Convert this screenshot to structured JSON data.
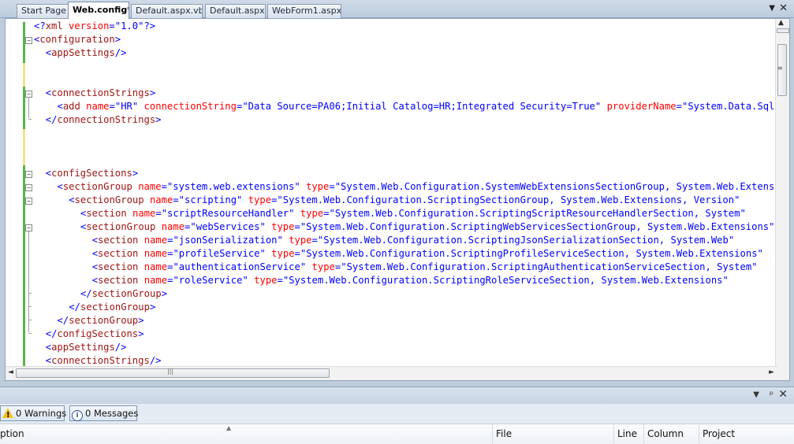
{
  "tabs": [
    {
      "label": "Start Page",
      "active": false
    },
    {
      "label": "Web.config*",
      "active": true
    },
    {
      "label": "Default.aspx.vb",
      "active": false
    },
    {
      "label": "Default.aspx",
      "active": false
    },
    {
      "label": "WebForm1.aspx",
      "active": false
    }
  ],
  "tab_icons": {
    "menu": "dropdown-arrow-icon",
    "close": "close-icon"
  },
  "editor": {
    "lines": [
      {
        "indent": 0,
        "segs": [
          [
            "b",
            "<?"
          ],
          [
            "t",
            "xml"
          ],
          [
            "a",
            " version"
          ],
          [
            "b",
            "="
          ],
          [
            "v",
            "\"1.0\""
          ],
          [
            "b",
            "?>"
          ]
        ]
      },
      {
        "indent": 0,
        "segs": [
          [
            "b",
            "<"
          ],
          [
            "t",
            "configuration"
          ],
          [
            "b",
            ">"
          ]
        ]
      },
      {
        "indent": 1,
        "segs": [
          [
            "b",
            "<"
          ],
          [
            "t",
            "appSettings"
          ],
          [
            "b",
            "/>"
          ]
        ]
      },
      {
        "indent": 0,
        "segs": []
      },
      {
        "indent": 0,
        "segs": []
      },
      {
        "indent": 1,
        "segs": [
          [
            "b",
            "<"
          ],
          [
            "t",
            "connectionStrings"
          ],
          [
            "b",
            ">"
          ]
        ]
      },
      {
        "indent": 2,
        "segs": [
          [
            "b",
            "<"
          ],
          [
            "t",
            "add"
          ],
          [
            "a",
            " name"
          ],
          [
            "b",
            "="
          ],
          [
            "v",
            "\"HR\""
          ],
          [
            "a",
            " connectionString"
          ],
          [
            "b",
            "="
          ],
          [
            "v",
            "\"Data Source=PA06;Initial Catalog=HR;Integrated Security=True\""
          ],
          [
            "a",
            " providerName"
          ],
          [
            "b",
            "="
          ],
          [
            "v",
            "\"System.Data.SqlClient\""
          ]
        ]
      },
      {
        "indent": 1,
        "segs": [
          [
            "b",
            "</"
          ],
          [
            "t",
            "connectionStrings"
          ],
          [
            "b",
            ">"
          ]
        ]
      },
      {
        "indent": 0,
        "segs": []
      },
      {
        "indent": 0,
        "segs": []
      },
      {
        "indent": 0,
        "segs": []
      },
      {
        "indent": 1,
        "segs": [
          [
            "b",
            "<"
          ],
          [
            "t",
            "configSections"
          ],
          [
            "b",
            ">"
          ]
        ]
      },
      {
        "indent": 2,
        "segs": [
          [
            "b",
            "<"
          ],
          [
            "t",
            "sectionGroup"
          ],
          [
            "a",
            " name"
          ],
          [
            "b",
            "="
          ],
          [
            "v",
            "\"system.web.extensions\""
          ],
          [
            "a",
            " type"
          ],
          [
            "b",
            "="
          ],
          [
            "v",
            "\"System.Web.Configuration.SystemWebExtensionsSectionGroup, System.Web.Extensions\""
          ]
        ]
      },
      {
        "indent": 3,
        "segs": [
          [
            "b",
            "<"
          ],
          [
            "t",
            "sectionGroup"
          ],
          [
            "a",
            " name"
          ],
          [
            "b",
            "="
          ],
          [
            "v",
            "\"scripting\""
          ],
          [
            "a",
            " type"
          ],
          [
            "b",
            "="
          ],
          [
            "v",
            "\"System.Web.Configuration.ScriptingSectionGroup, System.Web.Extensions, Version\""
          ]
        ]
      },
      {
        "indent": 4,
        "segs": [
          [
            "b",
            "<"
          ],
          [
            "t",
            "section"
          ],
          [
            "a",
            " name"
          ],
          [
            "b",
            "="
          ],
          [
            "v",
            "\"scriptResourceHandler\""
          ],
          [
            "a",
            " type"
          ],
          [
            "b",
            "="
          ],
          [
            "v",
            "\"System.Web.Configuration.ScriptingScriptResourceHandlerSection, System\""
          ]
        ]
      },
      {
        "indent": 4,
        "segs": [
          [
            "b",
            "<"
          ],
          [
            "t",
            "sectionGroup"
          ],
          [
            "a",
            " name"
          ],
          [
            "b",
            "="
          ],
          [
            "v",
            "\"webServices\""
          ],
          [
            "a",
            " type"
          ],
          [
            "b",
            "="
          ],
          [
            "v",
            "\"System.Web.Configuration.ScriptingWebServicesSectionGroup, System.Web.Extensions\""
          ]
        ]
      },
      {
        "indent": 5,
        "segs": [
          [
            "b",
            "<"
          ],
          [
            "t",
            "section"
          ],
          [
            "a",
            " name"
          ],
          [
            "b",
            "="
          ],
          [
            "v",
            "\"jsonSerialization\""
          ],
          [
            "a",
            " type"
          ],
          [
            "b",
            "="
          ],
          [
            "v",
            "\"System.Web.Configuration.ScriptingJsonSerializationSection, System.Web\""
          ]
        ]
      },
      {
        "indent": 5,
        "segs": [
          [
            "b",
            "<"
          ],
          [
            "t",
            "section"
          ],
          [
            "a",
            " name"
          ],
          [
            "b",
            "="
          ],
          [
            "v",
            "\"profileService\""
          ],
          [
            "a",
            " type"
          ],
          [
            "b",
            "="
          ],
          [
            "v",
            "\"System.Web.Configuration.ScriptingProfileServiceSection, System.Web.Extensions\""
          ]
        ]
      },
      {
        "indent": 5,
        "segs": [
          [
            "b",
            "<"
          ],
          [
            "t",
            "section"
          ],
          [
            "a",
            " name"
          ],
          [
            "b",
            "="
          ],
          [
            "v",
            "\"authenticationService\""
          ],
          [
            "a",
            " type"
          ],
          [
            "b",
            "="
          ],
          [
            "v",
            "\"System.Web.Configuration.ScriptingAuthenticationServiceSection, System\""
          ]
        ]
      },
      {
        "indent": 5,
        "segs": [
          [
            "b",
            "<"
          ],
          [
            "t",
            "section"
          ],
          [
            "a",
            " name"
          ],
          [
            "b",
            "="
          ],
          [
            "v",
            "\"roleService\""
          ],
          [
            "a",
            " type"
          ],
          [
            "b",
            "="
          ],
          [
            "v",
            "\"System.Web.Configuration.ScriptingRoleServiceSection, System.Web.Extensions\""
          ]
        ]
      },
      {
        "indent": 4,
        "segs": [
          [
            "b",
            "</"
          ],
          [
            "t",
            "sectionGroup"
          ],
          [
            "b",
            ">"
          ]
        ]
      },
      {
        "indent": 3,
        "segs": [
          [
            "b",
            "</"
          ],
          [
            "t",
            "sectionGroup"
          ],
          [
            "b",
            ">"
          ]
        ]
      },
      {
        "indent": 2,
        "segs": [
          [
            "b",
            "</"
          ],
          [
            "t",
            "sectionGroup"
          ],
          [
            "b",
            ">"
          ]
        ]
      },
      {
        "indent": 1,
        "segs": [
          [
            "b",
            "</"
          ],
          [
            "t",
            "configSections"
          ],
          [
            "b",
            ">"
          ]
        ]
      },
      {
        "indent": 1,
        "segs": [
          [
            "b",
            "<"
          ],
          [
            "t",
            "appSettings"
          ],
          [
            "b",
            "/>"
          ]
        ]
      },
      {
        "indent": 1,
        "segs": [
          [
            "b",
            "<"
          ],
          [
            "t",
            "connectionStrings"
          ],
          [
            "b",
            "/>"
          ]
        ]
      }
    ]
  },
  "colors": {
    "bracket": "#0000ff",
    "tag": "#a31515",
    "attribute": "#ff0000",
    "value": "#0000ff",
    "change_saved": "#58b54a",
    "change_unsaved": "#f0e28c"
  },
  "error_list": {
    "filters": {
      "warnings": "0 Warnings",
      "messages": "0 Messages"
    },
    "columns": [
      "ption",
      "File",
      "Line",
      "Column",
      "Project"
    ]
  }
}
